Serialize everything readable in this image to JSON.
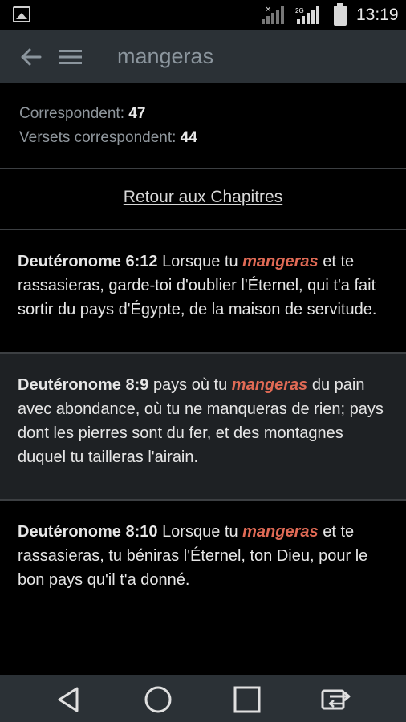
{
  "status_bar": {
    "time": "13:19",
    "network_label": "2G",
    "icons": [
      "image-icon",
      "signal-icon",
      "signal-2g-icon",
      "battery-icon"
    ]
  },
  "app_bar": {
    "title": "mangeras",
    "icons": [
      "back-arrow-icon",
      "menu-icon"
    ]
  },
  "stats": {
    "matches_label": "Correspondent:",
    "matches_value": "47",
    "verses_label": "Versets correspondent:",
    "verses_value": "44"
  },
  "retour_link": "Retour aux Chapitres",
  "verses": [
    {
      "reference": "Deutéronome 6:12",
      "before": "Lorsque tu",
      "highlight": "mangeras",
      "after": "et te rassasieras, garde-toi d'oublier l'Éternel, qui t'a fait sortir du pays d'Égypte, de la maison de servitude."
    },
    {
      "reference": "Deutéronome 8:9",
      "before": "pays où tu",
      "highlight": "mangeras",
      "after": "du pain avec abondance, où tu ne manqueras de rien; pays dont les pierres sont du fer, et des montagnes duquel tu tailleras l'airain."
    },
    {
      "reference": "Deutéronome 8:10",
      "before": "Lorsque tu",
      "highlight": "mangeras",
      "after": "et te rassasieras, tu béniras l'Éternel, ton Dieu, pour le bon pays qu'il t'a donné."
    }
  ],
  "colors": {
    "app_bar": "#2b3136",
    "highlight": "#e06a55",
    "alt_row": "#1e2124"
  },
  "nav_bar": {
    "icons": [
      "back-triangle-icon",
      "home-circle-icon",
      "recents-square-icon",
      "switch-sim-icon"
    ]
  }
}
